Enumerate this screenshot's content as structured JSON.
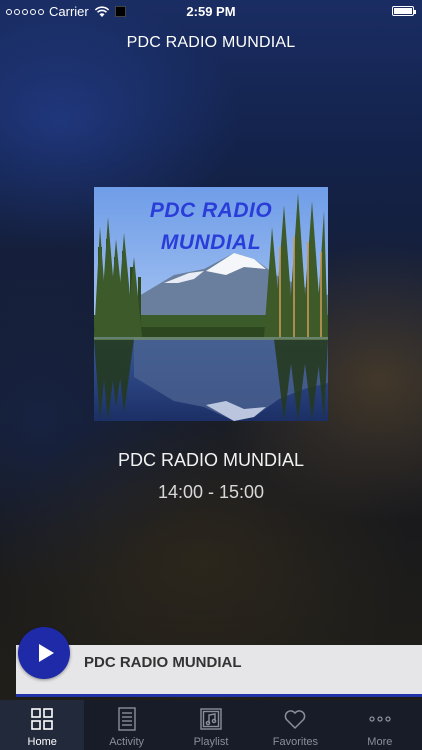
{
  "status_bar": {
    "carrier": "Carrier",
    "time": "2:59 PM"
  },
  "header": {
    "title": "PDC RADIO MUNDIAL"
  },
  "artwork": {
    "line1": "PDC RADIO",
    "line2": "MUNDIAL"
  },
  "now_playing": {
    "station": "PDC RADIO MUNDIAL",
    "schedule": "14:00 - 15:00"
  },
  "mini_player": {
    "title": "PDC RADIO MUNDIAL",
    "accent_color": "#1e2aa8"
  },
  "tabs": [
    {
      "label": "Home",
      "icon": "grid-icon",
      "active": true
    },
    {
      "label": "Activity",
      "icon": "list-icon",
      "active": false
    },
    {
      "label": "Playlist",
      "icon": "music-note-icon",
      "active": false
    },
    {
      "label": "Favorites",
      "icon": "heart-icon",
      "active": false
    },
    {
      "label": "More",
      "icon": "more-icon",
      "active": false
    }
  ]
}
